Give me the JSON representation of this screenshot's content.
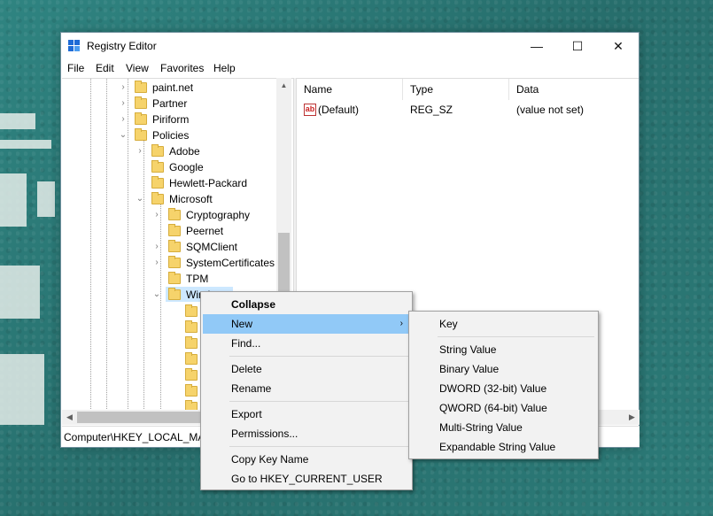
{
  "window": {
    "title": "Registry Editor",
    "minimize": "—",
    "maximize": "☐",
    "close": "✕"
  },
  "menu": [
    "File",
    "Edit",
    "View",
    "Favorites",
    "Help"
  ],
  "tree": {
    "items": [
      {
        "label": "paint.net",
        "expander": "›"
      },
      {
        "label": "Partner",
        "expander": "›"
      },
      {
        "label": "Piriform",
        "expander": "›"
      },
      {
        "label": "Policies",
        "expander": "⌄"
      },
      {
        "label": "Adobe",
        "expander": "›"
      },
      {
        "label": "Google",
        "expander": ""
      },
      {
        "label": "Hewlett-Packard",
        "expander": ""
      },
      {
        "label": "Microsoft",
        "expander": "⌄"
      },
      {
        "label": "Cryptography",
        "expander": "›"
      },
      {
        "label": "Peernet",
        "expander": ""
      },
      {
        "label": "SQMClient",
        "expander": "›"
      },
      {
        "label": "SystemCertificates",
        "expander": "›"
      },
      {
        "label": "TPM",
        "expander": ""
      },
      {
        "label": "Wind",
        "expander": "⌄"
      }
    ]
  },
  "list": {
    "columns": [
      "Name",
      "Type",
      "Data"
    ],
    "rows": [
      {
        "name": "(Default)",
        "type": "REG_SZ",
        "data": "(value not set)",
        "icon": "ab-icon"
      }
    ]
  },
  "status": "Computer\\HKEY_LOCAL_MA",
  "context_menu": {
    "items": [
      {
        "label": "Collapse",
        "bold": true
      },
      {
        "label": "New",
        "submenu": true,
        "arrow": "›"
      },
      {
        "label": "Find..."
      },
      {
        "label": "Delete"
      },
      {
        "label": "Rename"
      },
      {
        "label": "Export"
      },
      {
        "label": "Permissions..."
      },
      {
        "label": "Copy Key Name"
      },
      {
        "label": "Go to HKEY_CURRENT_USER"
      }
    ]
  },
  "submenu": {
    "items": [
      "Key",
      "String Value",
      "Binary Value",
      "DWORD (32-bit) Value",
      "QWORD (64-bit) Value",
      "Multi-String Value",
      "Expandable String Value"
    ]
  },
  "colors": {
    "highlight": "#91c9f7",
    "selection": "#cde8ff",
    "folder": "#f6d36b",
    "desktop": "#2e7f7c"
  }
}
